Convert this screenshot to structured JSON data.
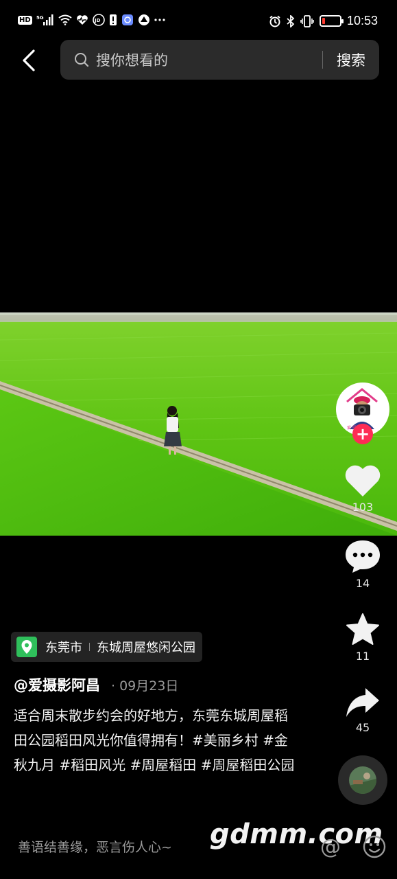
{
  "status_bar": {
    "left_badges": [
      "HD",
      "5G"
    ],
    "time": "10:53"
  },
  "search": {
    "placeholder": "搜你想看的",
    "button_label": "搜索"
  },
  "rail": {
    "like_count": "103",
    "comment_count": "14",
    "favorite_count": "11",
    "share_count": "45",
    "follow_symbol": "+"
  },
  "location": {
    "city": "东莞市",
    "place": "东城周屋悠闲公园"
  },
  "post": {
    "author": "@爱摄影阿昌",
    "date": "· 09月23日",
    "caption": "适合周末散步约会的好地方，东莞东城周屋稻田公园稻田风光你值得拥有！#美丽乡村 #金秋九月 #稻田风光 #周屋稻田 #周屋稻田公园"
  },
  "comment_bar": {
    "placeholder": "善语结善缘，恶言伤人心~",
    "at_symbol": "@"
  },
  "watermark": "gdmm.com",
  "colors": {
    "accent": "#fe2c55",
    "location_pin": "#2fbf5b",
    "battery_low": "#ff3b30"
  }
}
